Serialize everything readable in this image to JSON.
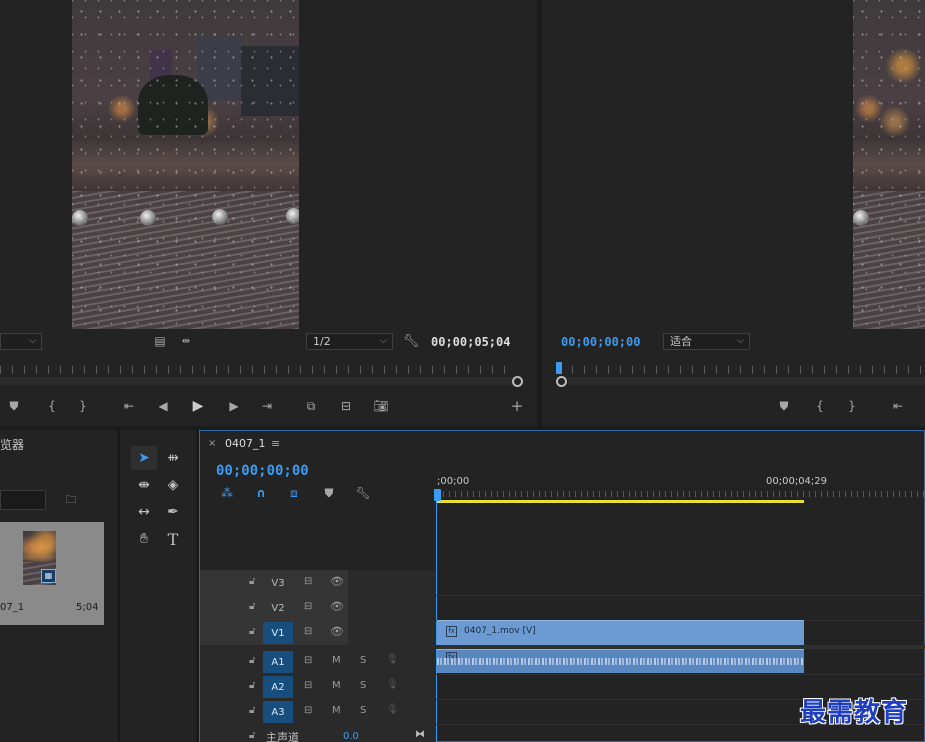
{
  "source_monitor": {
    "zoom_value": "1/2",
    "timecode": "00;00;05;04"
  },
  "program_monitor": {
    "timecode": "00;00;00;00",
    "zoom_value": "适合"
  },
  "project_panel": {
    "title_fragment": "览器",
    "clip_name": "07_1",
    "clip_duration": "5;04"
  },
  "timeline": {
    "sequence_name": "0407_1",
    "playhead_timecode": "00;00;00;00",
    "ruler_start": ";00;00",
    "ruler_end": "00;00;04;29",
    "video_clip_label": "0407_1.mov [V]",
    "master_label": "主声道",
    "master_value": "0.0",
    "tracks": {
      "v3": "V3",
      "v2": "V2",
      "v1": "V1",
      "a1": "A1",
      "a2": "A2",
      "a3": "A3",
      "mute": "M",
      "solo": "S"
    }
  },
  "watermark": "最需教育",
  "colors": {
    "accent_blue": "#3a9bf2",
    "clip_blue": "#6b9bd2",
    "work_area_yellow": "#e4df3b",
    "panel_bg": "#232323"
  }
}
